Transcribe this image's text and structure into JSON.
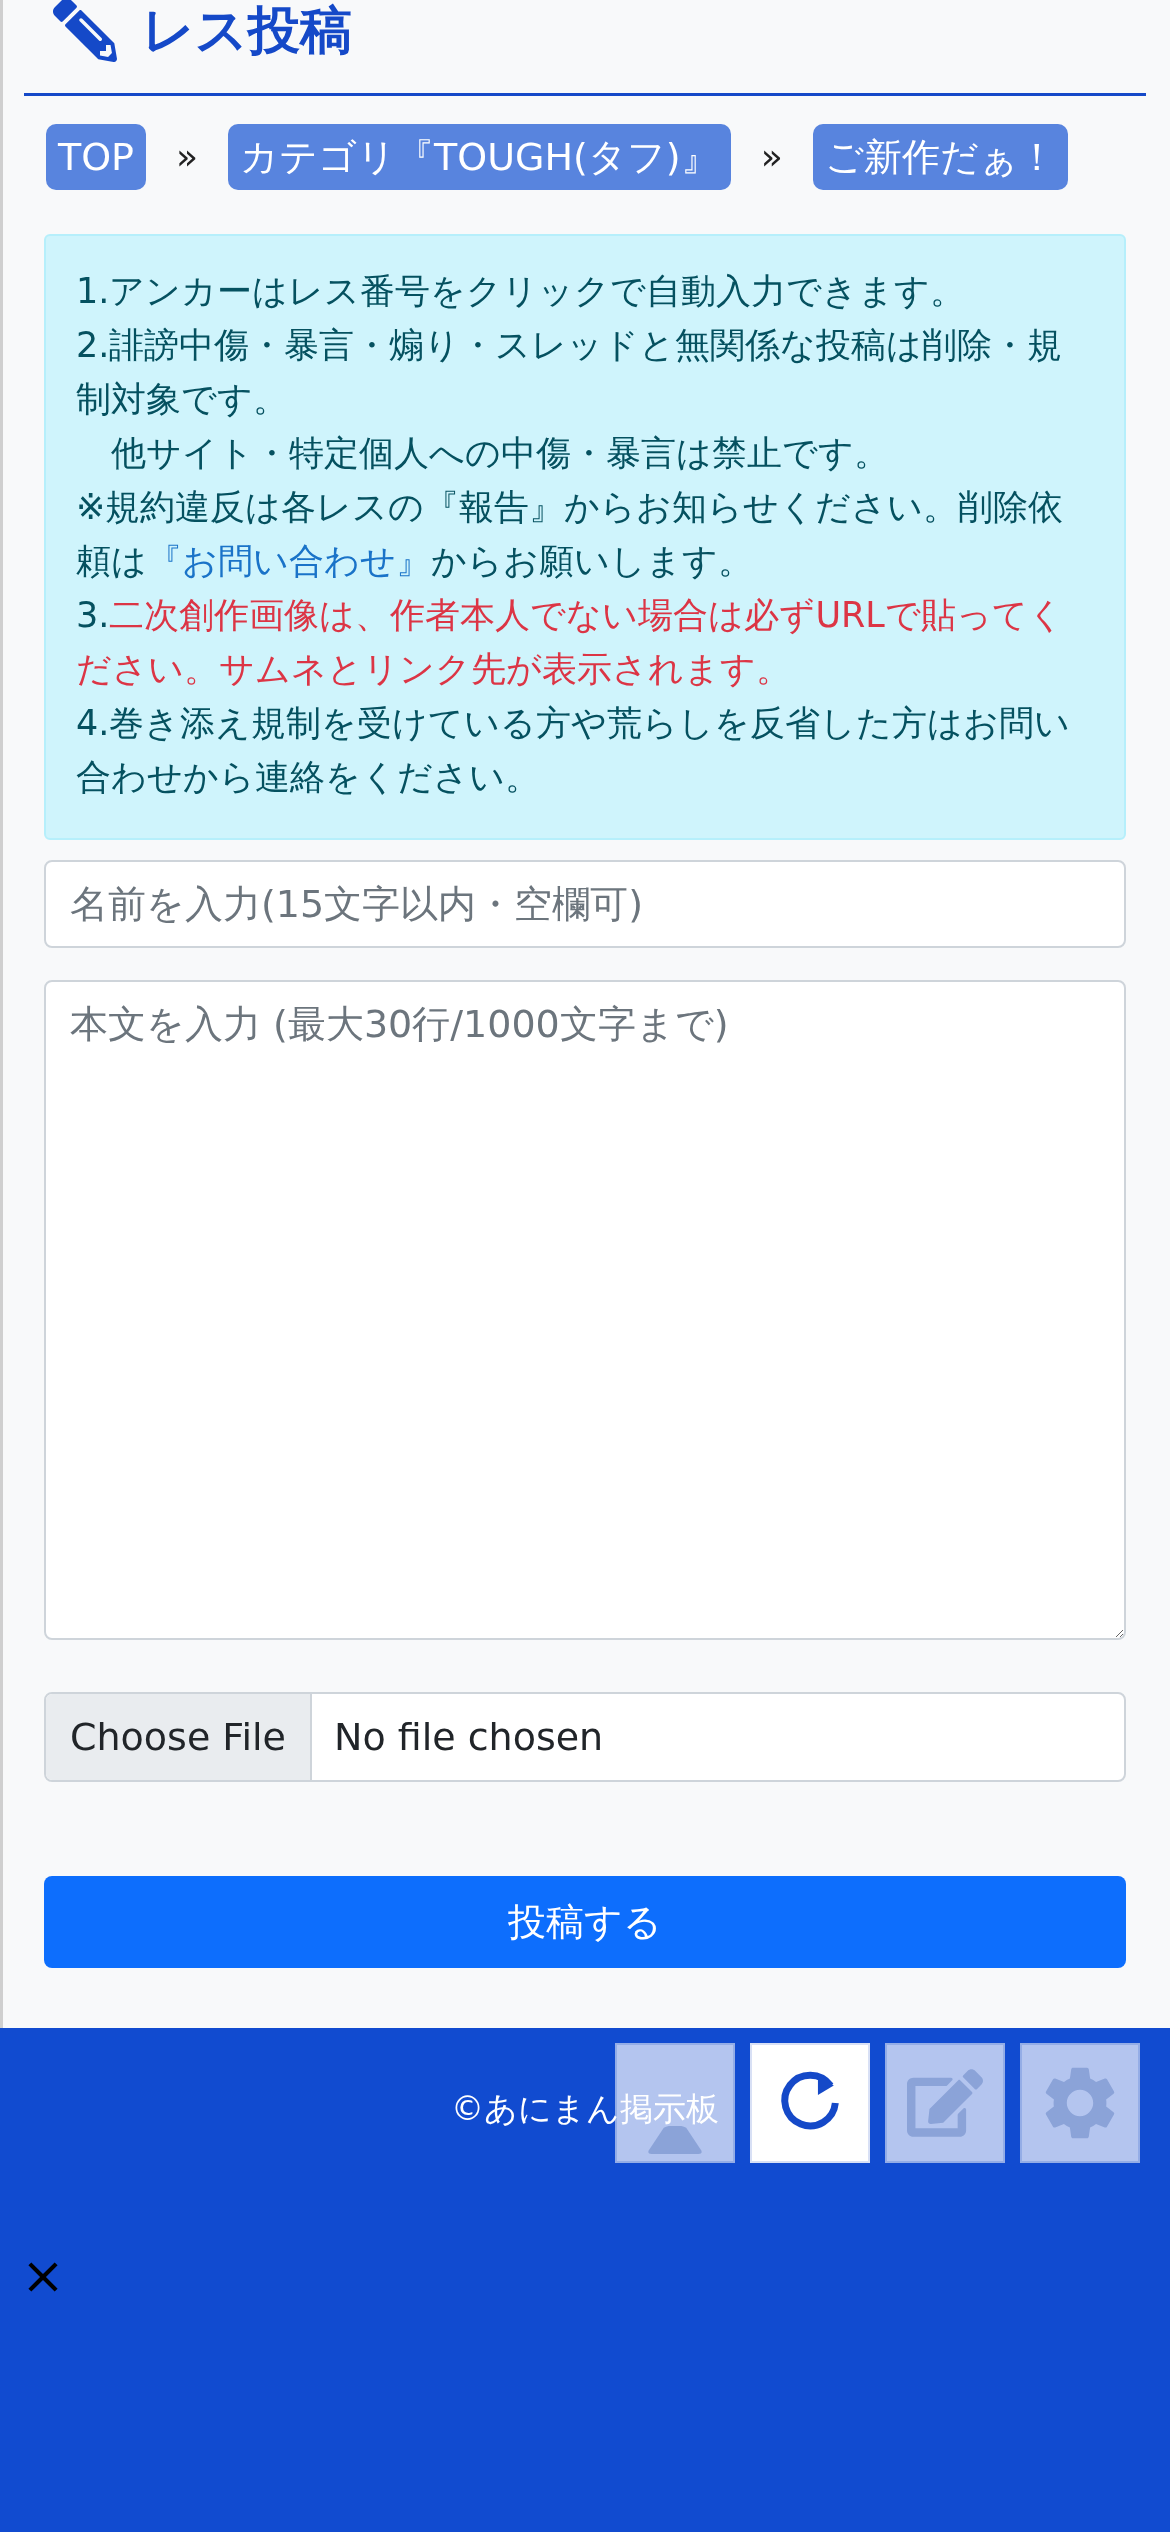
{
  "header": {
    "title": "レス投稿"
  },
  "breadcrumbs": [
    {
      "label": "TOP"
    },
    {
      "label": "カテゴリ『TOUGH(タフ)』"
    },
    {
      "label": "ご新作だぁ！"
    }
  ],
  "breadcrumb_separator": "»",
  "notice": {
    "paragraphs": [
      {
        "segments": [
          {
            "kind": "text",
            "text": "1.アンカーはレス番号をクリックで自動入力できます。"
          }
        ]
      },
      {
        "segments": [
          {
            "kind": "text",
            "text": "2.誹謗中傷・暴言・煽り・スレッドと無関係な投稿は削除・規制対象です。"
          }
        ]
      },
      {
        "segments": [
          {
            "kind": "text",
            "text": "　他サイト・特定個人への中傷・暴言は禁止です。"
          }
        ]
      },
      {
        "segments": [
          {
            "kind": "text",
            "text": "※規約違反は各レスの『報告』からお知らせください。削除依頼は"
          },
          {
            "kind": "link",
            "text": "『お問い合わせ』"
          },
          {
            "kind": "text",
            "text": "からお願いします。"
          }
        ]
      },
      {
        "segments": [
          {
            "kind": "text",
            "text": "3."
          },
          {
            "kind": "warning",
            "text": "二次創作画像は、作者本人でない場合は必ずURLで貼ってください。サムネとリンク先が表示されます。"
          }
        ]
      },
      {
        "segments": [
          {
            "kind": "text",
            "text": "4.巻き添え規制を受けている方や荒らしを反省した方はお問い合わせから連絡をください。"
          }
        ]
      }
    ]
  },
  "form": {
    "name_placeholder": "名前を入力(15文字以内・空欄可)",
    "body_placeholder": "本文を入力 (最大30行/1000文字まで)",
    "file_button": "Choose File",
    "file_status": "No file chosen",
    "submit": "投稿する"
  },
  "footer": {
    "copyright": "©あにまん掲示板"
  },
  "floating_buttons": [
    {
      "kind": "top",
      "disabled": true
    },
    {
      "kind": "reload",
      "disabled": false
    },
    {
      "kind": "post",
      "disabled": true
    },
    {
      "kind": "settings",
      "disabled": true
    }
  ]
}
